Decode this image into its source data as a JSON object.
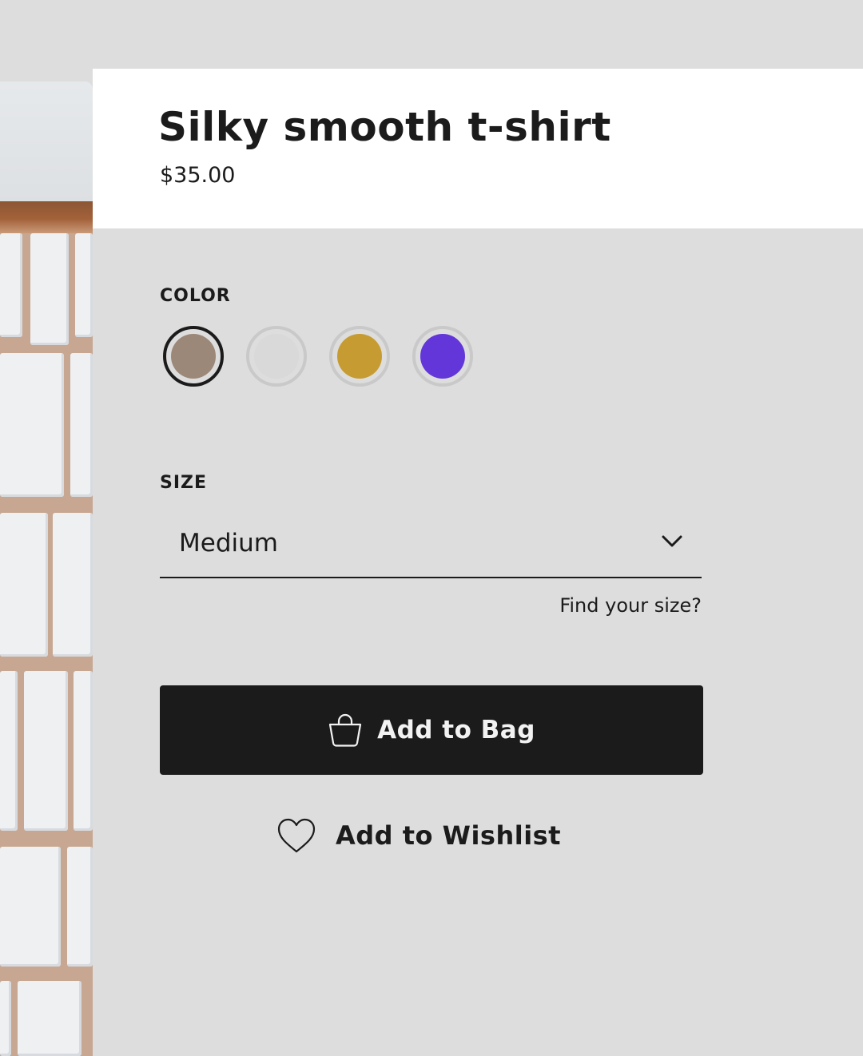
{
  "product": {
    "title": "Silky smooth t-shirt",
    "price": "$35.00"
  },
  "color_picker": {
    "label": "COLOR",
    "selected_index": 0,
    "swatches": [
      {
        "color": "#9c8878",
        "selected": true
      },
      {
        "color": "#d9d9d9",
        "selected": false
      },
      {
        "color": "#c69b31",
        "selected": false
      },
      {
        "color": "#6236d9",
        "selected": false
      }
    ]
  },
  "size_picker": {
    "label": "SIZE",
    "selected_value": "Medium",
    "icon": "chevron-down-icon",
    "help_link": "Find your size?"
  },
  "actions": {
    "add_to_bag": {
      "label": "Add to Bag",
      "icon": "shopping-bag-icon"
    },
    "add_to_wishlist": {
      "label": "Add to Wishlist",
      "icon": "heart-icon"
    }
  },
  "colors": {
    "background": "#dddddd",
    "header_background": "#ffffff",
    "primary_button": "#1b1b1b",
    "text": "#1b1b1b"
  }
}
